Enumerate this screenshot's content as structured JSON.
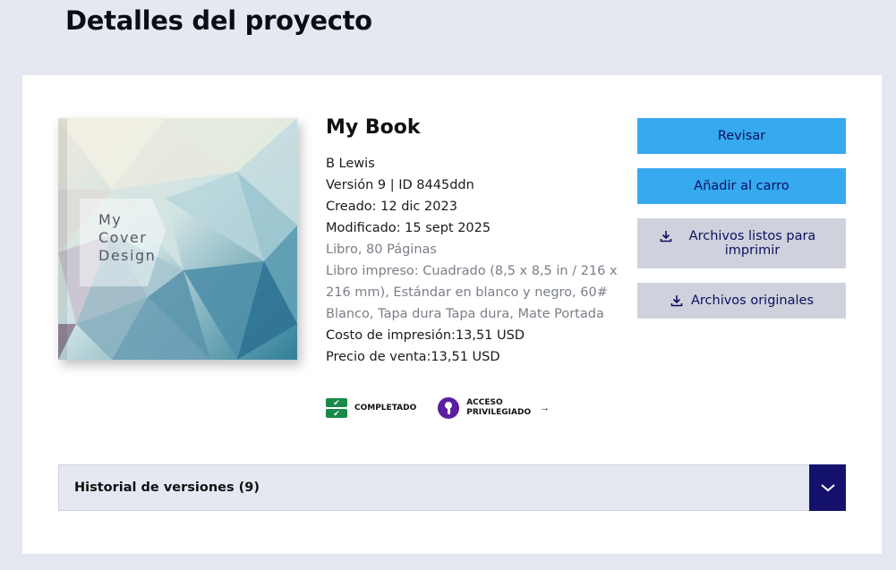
{
  "page": {
    "title": "Detalles del proyecto"
  },
  "cover": {
    "text_lines": [
      "My",
      "Cover",
      "Design"
    ]
  },
  "book": {
    "title": "My Book",
    "author": "B Lewis",
    "version": "Versión 9 | ID 8445ddn",
    "created": "Creado: 12 dic 2023",
    "modified": "Modificado: 15 sept 2025",
    "format": "Libro, 80 Páginas",
    "spec": "Libro impreso: Cuadrado (8,5 x 8,5 in / 216 x 216 mm), Estándar en blanco y negro, 60# Blanco, Tapa dura Tapa dura, Mate Portada",
    "print_cost": "Costo de impresión:13,51 USD",
    "sale_price": "Precio de venta:13,51 USD"
  },
  "badges": {
    "completed": "COMPLETADO",
    "access_line1": "ACCESO",
    "access_line2": "PRIVILEGIADO"
  },
  "actions": {
    "review": "Revisar",
    "add_to_cart": "Añadir al carro",
    "print_ready_files": "Archivos listos para imprimir",
    "original_files": "Archivos originales"
  },
  "history": {
    "label": "Historial de versiones (9)"
  },
  "colors": {
    "primary_button": "#36a9ef",
    "secondary_button": "#cfd2dc",
    "button_text": "#0d1060",
    "complete_green": "#1a8a4a",
    "access_purple": "#5a1ea0",
    "toggle_navy": "#15126e"
  },
  "icons": {
    "download": "download-icon",
    "check": "check-icon",
    "key": "key-icon",
    "arrow": "arrow-right-icon",
    "chevron": "chevron-down-icon"
  }
}
